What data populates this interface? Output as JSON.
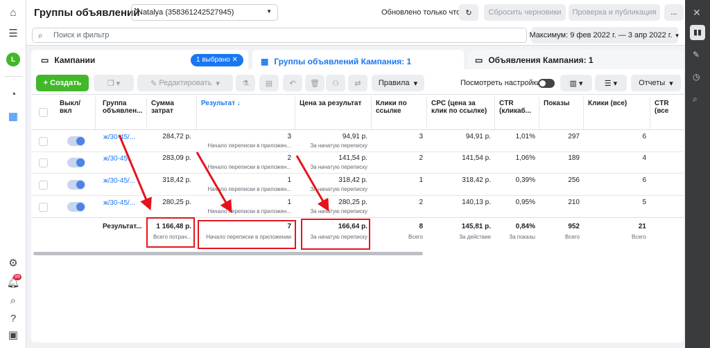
{
  "header": {
    "title": "Группы объявлений",
    "account": "Natalya (358361242527945)",
    "updated": "Обновлено только что",
    "discard": "Сбросить черновики",
    "publish": "Проверка и публикация",
    "more": "..."
  },
  "search": {
    "placeholder": "Поиск и фильтр"
  },
  "date_range": "Максимум: 9 фев 2022 г. — 3 апр 2022 г.",
  "tabs": {
    "campaigns": "Кампании",
    "selected_badge": "1 выбрано",
    "adsets": "Группы объявлений Кампания: 1",
    "ads": "Объявления Кампания: 1"
  },
  "toolbar": {
    "create": "+ Создать",
    "edit": "Редактировать",
    "rules": "Правила",
    "view_settings": "Посмотреть настройки",
    "reports": "Отчеты"
  },
  "columns": {
    "onoff": "Выкл/ вкл",
    "adset": "Группа объявлен...",
    "spend": "Сумма затрат",
    "result": "Результат ↓",
    "cost": "Цена за результат",
    "clicks_link": "Клики по ссылке",
    "cpc": "CPC (цена за клик по ссылке)",
    "ctr": "CTR (кликаб...",
    "impr": "Показы",
    "clicks_all": "Клики (все)",
    "ctr_all": "CTR (все"
  },
  "rows": [
    {
      "name": "ж/30-45/...",
      "spend": "284,72 р.",
      "result": "3",
      "result_sub": "Начало переписки в приложен...",
      "cost": "94,91 р.",
      "cost_sub": "За начатую переписку",
      "clicks_link": "3",
      "cpc": "94,91 р.",
      "ctr": "1,01%",
      "impr": "297",
      "clicks_all": "6"
    },
    {
      "name": "ж/30-45...",
      "spend": "283,09 р.",
      "result": "2",
      "result_sub": "Начало переписки в приложен...",
      "cost": "141,54 р.",
      "cost_sub": "За начатую переписку",
      "clicks_link": "2",
      "cpc": "141,54 р.",
      "ctr": "1,06%",
      "impr": "189",
      "clicks_all": "4"
    },
    {
      "name": "ж/30-45/...",
      "spend": "318,42 р.",
      "result": "1",
      "result_sub": "Начало переписки в приложен...",
      "cost": "318,42 р.",
      "cost_sub": "За начатую переписку",
      "clicks_link": "1",
      "cpc": "318,42 р.",
      "ctr": "0,39%",
      "impr": "256",
      "clicks_all": "6"
    },
    {
      "name": "ж/30-45/...",
      "spend": "280,25 р.",
      "result": "1",
      "result_sub": "Начало переписки в приложен...",
      "cost": "280,25 р.",
      "cost_sub": "За начатую переписку",
      "clicks_link": "2",
      "cpc": "140,13 р.",
      "ctr": "0,95%",
      "impr": "210",
      "clicks_all": "5"
    }
  ],
  "totals": {
    "label": "Результат...",
    "spend": "1 166,48 р.",
    "spend_sub": "Всего потрач...",
    "result": "7",
    "result_sub": "Начало переписки в приложении",
    "cost": "166,64 р.",
    "cost_sub": "За начатую переписку",
    "clicks_link": "8",
    "clicks_link_sub": "Всего",
    "cpc": "145,81 р.",
    "cpc_sub": "За действие",
    "ctr": "0,84%",
    "ctr_sub": "За показы",
    "impr": "952",
    "impr_sub": "Всего",
    "clicks_all": "21",
    "clicks_all_sub": "Всего"
  },
  "notifications_badge": "99",
  "avatar_letter": "L"
}
